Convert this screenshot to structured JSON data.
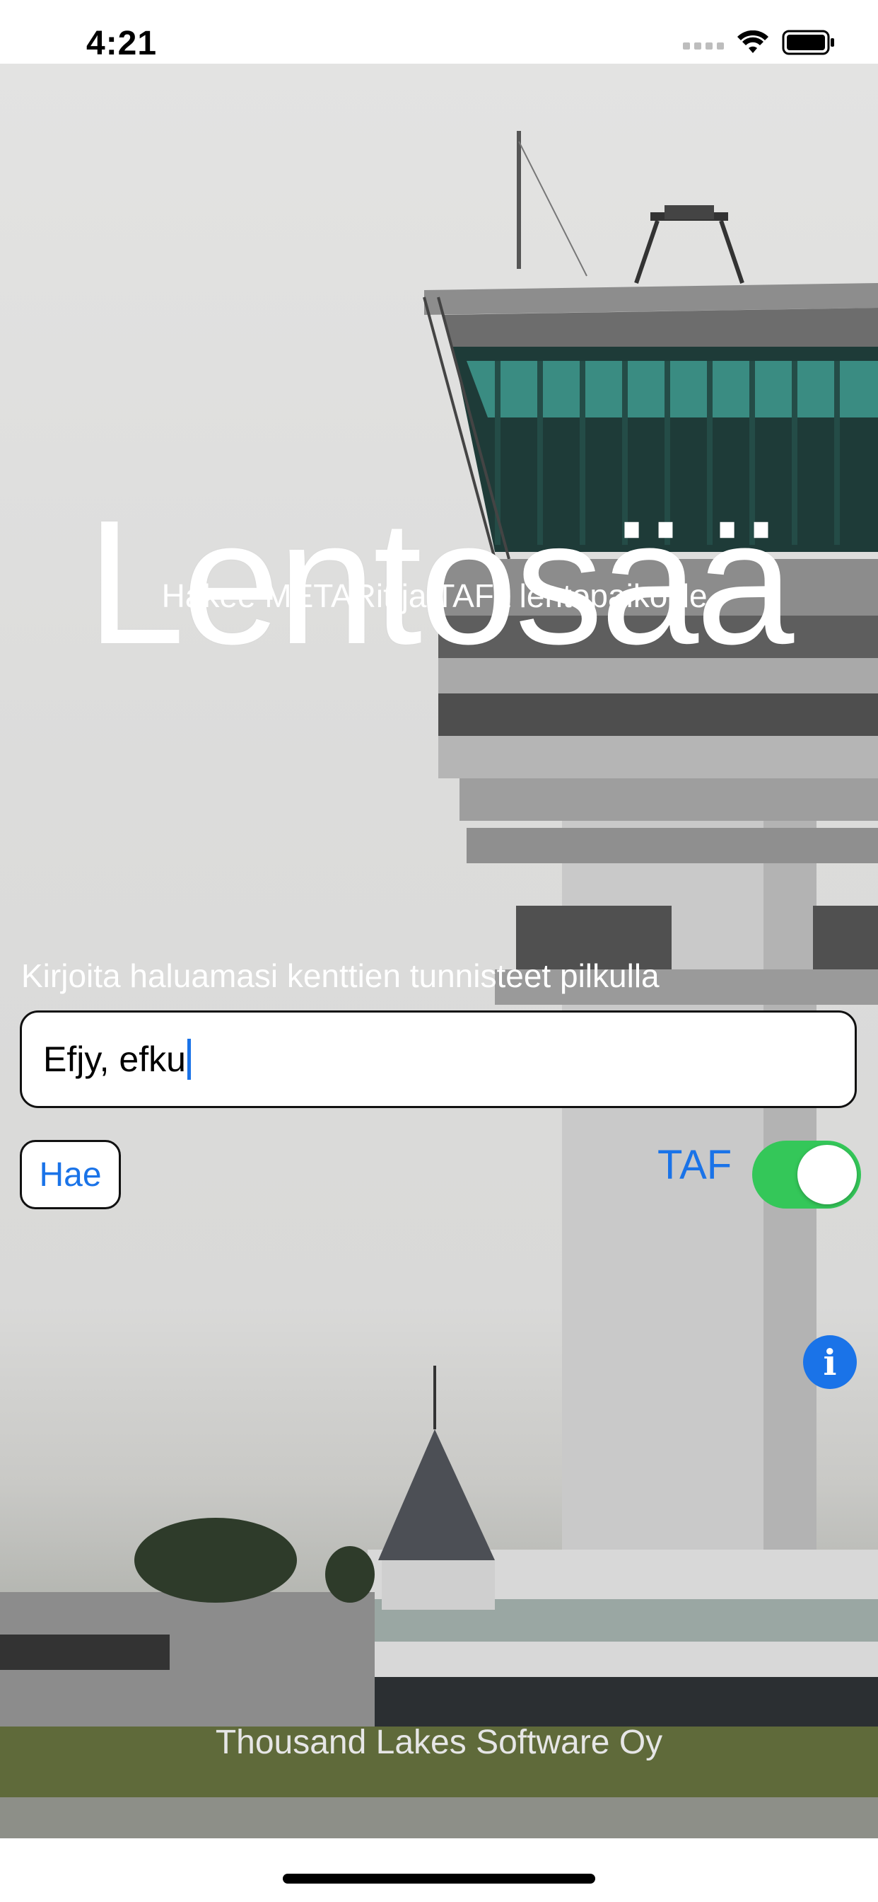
{
  "status_bar": {
    "time": "4:21",
    "icons": [
      "cellular-signal-icon",
      "wifi-icon",
      "battery-icon"
    ]
  },
  "app": {
    "title": "Lentosää",
    "subtitle": "Hakee METARit ja TAFit lentopaikoille."
  },
  "form": {
    "instruction": "Kirjoita haluamasi kenttien tunnisteet pilkulla erotettuina.",
    "input_value": "Efjy, efku",
    "search_button_label": "Hae",
    "taf_toggle": {
      "label": "TAF",
      "on": true
    }
  },
  "info_button": {
    "icon": "info-icon",
    "glyph": "i"
  },
  "footer": {
    "company": "Thousand Lakes Software Oy"
  },
  "colors": {
    "accent": "#1a73e8",
    "toggle_on": "#34c759"
  }
}
